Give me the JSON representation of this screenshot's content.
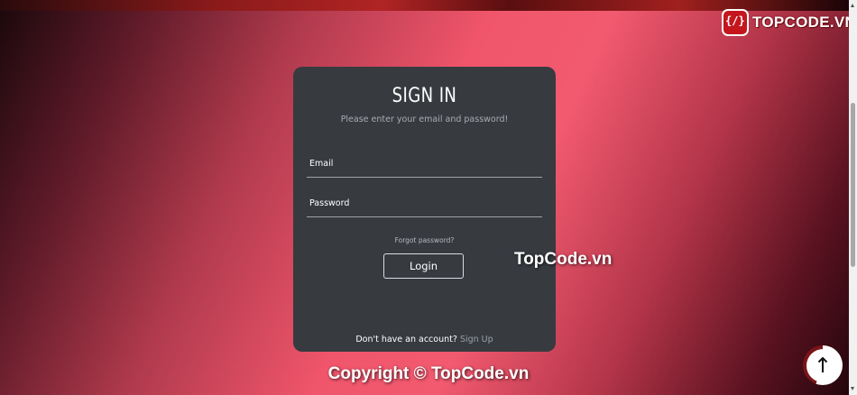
{
  "brand": {
    "logo_text": "TOPCODE.VN"
  },
  "signin": {
    "title": "SIGN IN",
    "subtitle": "Please enter your email and password!",
    "email_label": "Email",
    "password_label": "Password",
    "forgot_label": "Forgot password?",
    "login_label": "Login",
    "signup_prompt": "Don't have an account?",
    "signup_link": "Sign Up"
  },
  "watermark": "TopCode.vn",
  "footer": {
    "copyright": "Copyright © TopCode.vn"
  },
  "scroll_top": {
    "icon": "arrow-up-icon",
    "glyph": "↑"
  },
  "colors": {
    "card_bg": "#373b40",
    "gradient_pink": "#f0556b",
    "gradient_dark": "#1a080c",
    "brand_red": "#c5161d"
  }
}
